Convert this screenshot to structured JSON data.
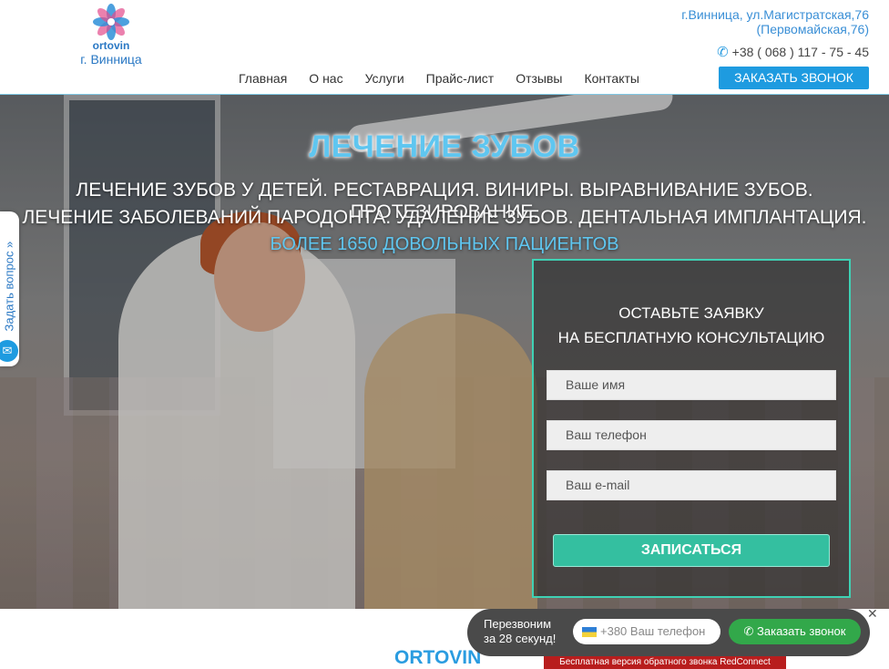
{
  "header": {
    "logo_name": "ortovin",
    "logo_city": "г. Винница",
    "address_line1": "г.Винница, ул.Магистратская,76",
    "address_line2": "(Первомайская,76)",
    "phone": "+38 ( 068 ) 117 - 75 - 45",
    "call_button": "ЗАКАЗАТЬ ЗВОНОК",
    "nav": [
      "Главная",
      "О нас",
      "Услуги",
      "Прайс-лист",
      "Отзывы",
      "Контакты"
    ]
  },
  "hero": {
    "title": "ЛЕЧЕНИЕ ЗУБОВ",
    "sub1": "ЛЕЧЕНИЕ ЗУБОВ У ДЕТЕЙ. РЕСТАВРАЦИЯ. ВИНИРЫ. ВЫРАВНИВАНИЕ ЗУБОВ. ПРОТЕЗИРОВАНИЕ.",
    "sub2": "ЛЕЧЕНИЕ ЗАБОЛЕВАНИЙ ПАРОДОНТА. УДАЛЕНИЕ ЗУБОВ. ДЕНТАЛЬНАЯ ИМПЛАНТАЦИЯ.",
    "sub3": "БОЛЕЕ 1650 ДОВОЛЬНЫХ ПАЦИЕНТОВ"
  },
  "side_tab": {
    "label": "Задать вопрос »"
  },
  "form": {
    "title_line1": "ОСТАВЬТЕ ЗАЯВКУ",
    "title_line2": "НА БЕСПЛАТНУЮ КОНСУЛЬТАЦИЮ",
    "name_placeholder": "Ваше имя",
    "phone_placeholder": "Ваш телефон",
    "email_placeholder": "Ваш e-mail",
    "submit": "ЗАПИСАТЬСЯ"
  },
  "bottom": {
    "title": "ORTOVIN"
  },
  "widget": {
    "text_line1": "Перезвоним",
    "text_line2": "за 28 секунд!",
    "input_placeholder": "+380 Ваш телефон",
    "button": "Заказать звонок",
    "close": "✕",
    "footer": "Бесплатная версия обратного звонка RedConnect"
  },
  "colors": {
    "accent": "#1e9be0",
    "teal": "#34bfa0",
    "title_blue": "#5fc6f0"
  }
}
